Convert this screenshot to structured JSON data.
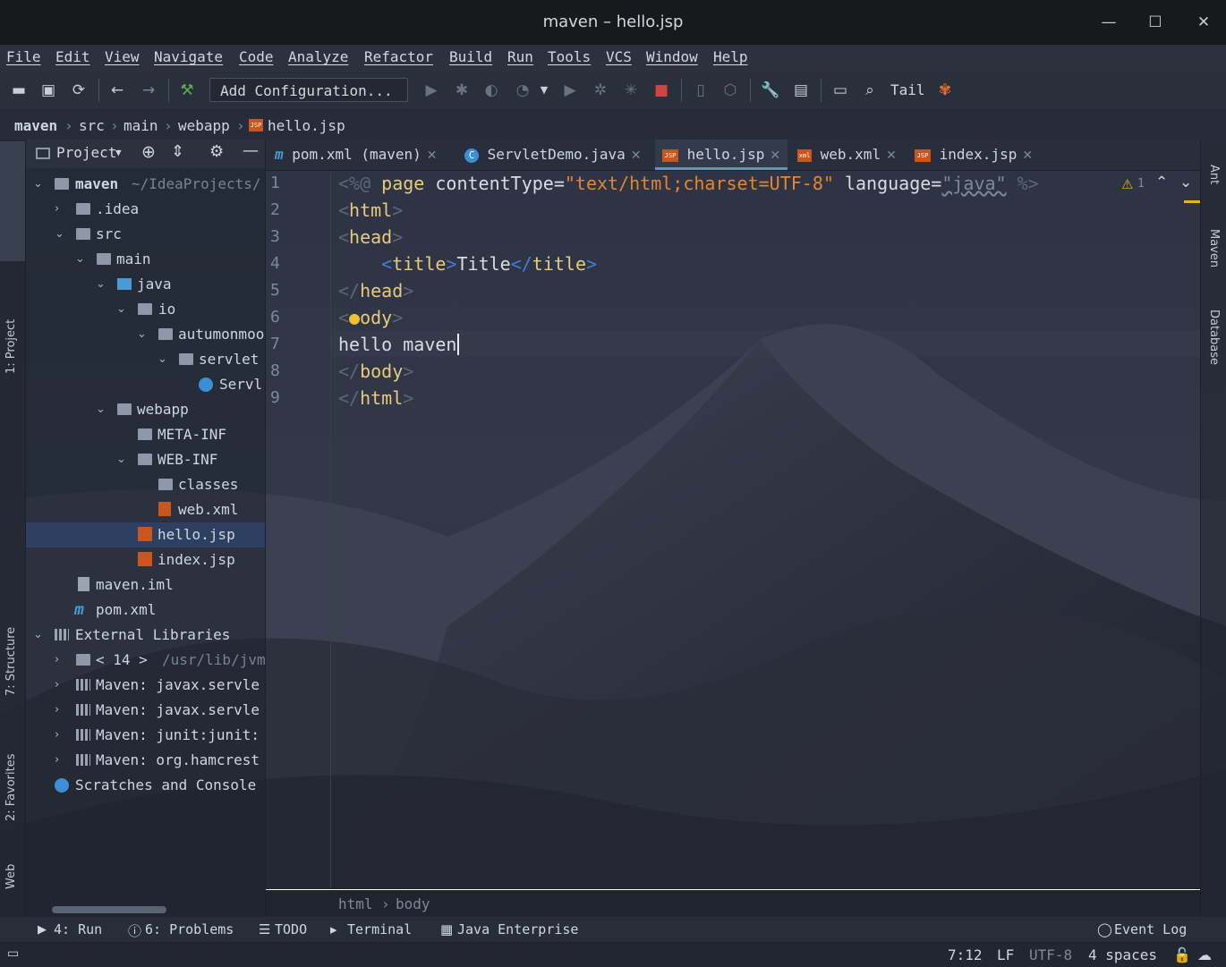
{
  "window": {
    "title": "maven – hello.jsp",
    "minimize": "—",
    "maximize": "☐",
    "close": "✕"
  },
  "menu": [
    "File",
    "Edit",
    "View",
    "Navigate",
    "Code",
    "Analyze",
    "Refactor",
    "Build",
    "Run",
    "Tools",
    "VCS",
    "Window",
    "Help"
  ],
  "toolbar": {
    "add_configuration": "Add Configuration...",
    "tail": "Tail"
  },
  "breadcrumb": [
    "maven",
    "src",
    "main",
    "webapp",
    "hello.jsp"
  ],
  "left_tabs": {
    "project": "1: Project",
    "structure": "7: Structure",
    "favorites": "2: Favorites",
    "web": "Web"
  },
  "right_tabs": {
    "ant": "Ant",
    "maven": "Maven",
    "database": "Database"
  },
  "project_panel": {
    "title": "Project",
    "tree": [
      {
        "name": "maven",
        "extra": "~/IdeaProjects/",
        "bold": true
      },
      {
        "name": ".idea"
      },
      {
        "name": "src"
      },
      {
        "name": "main"
      },
      {
        "name": "java"
      },
      {
        "name": "io"
      },
      {
        "name": "autumonmoo"
      },
      {
        "name": "servlet"
      },
      {
        "name": "Servl"
      },
      {
        "name": "webapp"
      },
      {
        "name": "META-INF"
      },
      {
        "name": "WEB-INF"
      },
      {
        "name": "classes"
      },
      {
        "name": "web.xml"
      },
      {
        "name": "hello.jsp"
      },
      {
        "name": "index.jsp"
      },
      {
        "name": "maven.iml"
      },
      {
        "name": "pom.xml"
      },
      {
        "name": "External Libraries"
      },
      {
        "name": "< 14 >",
        "extra": "/usr/lib/jvm"
      },
      {
        "name": "Maven: javax.servle"
      },
      {
        "name": "Maven: javax.servle"
      },
      {
        "name": "Maven: junit:junit:"
      },
      {
        "name": "Maven: org.hamcrest"
      },
      {
        "name": "Scratches and Console"
      }
    ]
  },
  "editor_tabs": [
    {
      "label": "pom.xml (maven)",
      "icon": "m"
    },
    {
      "label": "ServletDemo.java",
      "icon": "C"
    },
    {
      "label": "hello.jsp",
      "icon": "JSP"
    },
    {
      "label": "web.xml",
      "icon": "xml"
    },
    {
      "label": "index.jsp",
      "icon": "JSP"
    }
  ],
  "editor": {
    "line_numbers": [
      "1",
      "2",
      "3",
      "4",
      "5",
      "6",
      "7",
      "8",
      "9"
    ],
    "inspection_count": "1",
    "code": {
      "l1_open": "<%@",
      "l1_page": "page",
      "l1_attr1": "contentType=",
      "l1_val1": "\"text/html;charset=UTF-8\"",
      "l1_attr2": "language=",
      "l1_val2": "\"java\"",
      "l1_close": "%>",
      "l2_tag": "html",
      "l3_tag": "head",
      "l4_tag": "title",
      "l4_text": "Title",
      "l5_tag": "head",
      "l6_tag": "ody",
      "l7_text": "hello maven",
      "l8_tag": "body",
      "l9_tag": "html"
    },
    "bottom_path": [
      "html",
      "body"
    ]
  },
  "bottom_tools": {
    "run": "4: Run",
    "problems": "6: Problems",
    "todo": "TODO",
    "terminal": "Terminal",
    "java_enterprise": "Java Enterprise",
    "event_log": "Event Log"
  },
  "status": {
    "position": "7:12",
    "line_sep": "LF",
    "encoding": "UTF-8",
    "indent": "4 spaces"
  }
}
